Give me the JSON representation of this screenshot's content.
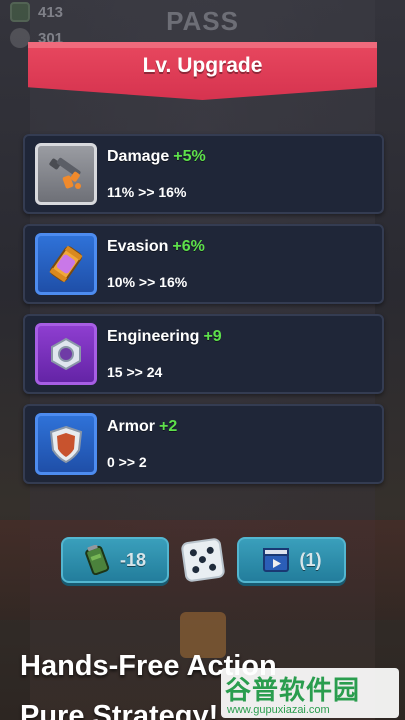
{
  "header": {
    "pass_label": "PASS",
    "resources": [
      {
        "icon": "battery-icon",
        "value": "413"
      },
      {
        "icon": "skull-icon",
        "value": "301"
      }
    ]
  },
  "dialog": {
    "title": "Lv. Upgrade",
    "upgrades": [
      {
        "icon": "rifle-icon",
        "name": "Damage",
        "bonus": "+5%",
        "change": "11% >> 16%",
        "tile_color": "#8c8e94"
      },
      {
        "icon": "canister-icon",
        "name": "Evasion",
        "bonus": "+6%",
        "change": "10% >> 16%",
        "tile_color": "#2b66c9"
      },
      {
        "icon": "hex-nut-icon",
        "name": "Engineering",
        "bonus": "+9",
        "change": "15 >> 24",
        "tile_color": "#7a33bd"
      },
      {
        "icon": "shield-icon",
        "name": "Armor",
        "bonus": "+2",
        "change": "0 >> 2",
        "tile_color": "#2b66c9"
      }
    ]
  },
  "actions": {
    "reroll_cost": "-18",
    "reroll_icon": "battery-icon",
    "dice_icon": "dice-icon",
    "ad_icon": "clapperboard-icon",
    "ad_count": "(1)"
  },
  "promo": {
    "line1": "Hands-Free Action",
    "line2": "Pure Strategy!"
  },
  "watermark": {
    "logo": "谷普软件园",
    "url": "www.gupuxiazai.com"
  },
  "colors": {
    "ribbon": "#de3d56",
    "bonus_green": "#5ee04b",
    "card_bg": "#1f2638",
    "button": "#2f9cbd"
  }
}
